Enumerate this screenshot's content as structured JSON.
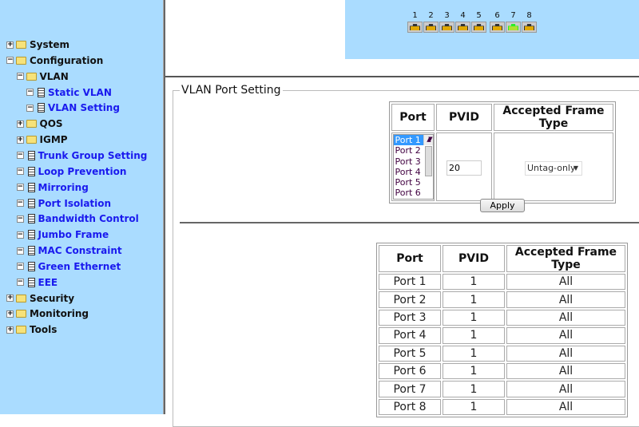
{
  "sidebar": {
    "items": [
      {
        "label": "System",
        "level": 0,
        "expander": "+",
        "icon": "folder-icon",
        "color": "black"
      },
      {
        "label": "Configuration",
        "level": 0,
        "expander": "-",
        "icon": "folder-open-icon",
        "color": "black"
      },
      {
        "label": "VLAN",
        "level": 1,
        "expander": "-",
        "icon": "folder-open-icon",
        "color": "black"
      },
      {
        "label": "Static VLAN",
        "level": 2,
        "expander": "-",
        "icon": "document-icon",
        "color": "blue"
      },
      {
        "label": "VLAN Setting",
        "level": 2,
        "expander": "-",
        "icon": "document-icon",
        "color": "blue"
      },
      {
        "label": "QOS",
        "level": 1,
        "expander": "+",
        "icon": "folder-icon",
        "color": "black"
      },
      {
        "label": "IGMP",
        "level": 1,
        "expander": "+",
        "icon": "folder-icon",
        "color": "black"
      },
      {
        "label": "Trunk Group Setting",
        "level": 1,
        "expander": "-",
        "icon": "document-icon",
        "color": "blue"
      },
      {
        "label": "Loop Prevention",
        "level": 1,
        "expander": "-",
        "icon": "document-icon",
        "color": "blue"
      },
      {
        "label": "Mirroring",
        "level": 1,
        "expander": "-",
        "icon": "document-icon",
        "color": "blue"
      },
      {
        "label": "Port Isolation",
        "level": 1,
        "expander": "-",
        "icon": "document-icon",
        "color": "blue"
      },
      {
        "label": "Bandwidth Control",
        "level": 1,
        "expander": "-",
        "icon": "document-icon",
        "color": "blue"
      },
      {
        "label": "Jumbo Frame",
        "level": 1,
        "expander": "-",
        "icon": "document-icon",
        "color": "blue"
      },
      {
        "label": "MAC Constraint",
        "level": 1,
        "expander": "-",
        "icon": "document-icon",
        "color": "blue"
      },
      {
        "label": "Green Ethernet",
        "level": 1,
        "expander": "-",
        "icon": "document-icon",
        "color": "blue"
      },
      {
        "label": "EEE",
        "level": 1,
        "expander": "-",
        "icon": "document-icon",
        "color": "blue"
      },
      {
        "label": "Security",
        "level": 0,
        "expander": "+",
        "icon": "folder-icon",
        "color": "black"
      },
      {
        "label": "Monitoring",
        "level": 0,
        "expander": "+",
        "icon": "folder-icon",
        "color": "black"
      },
      {
        "label": "Tools",
        "level": 0,
        "expander": "+",
        "icon": "folder-icon",
        "color": "black"
      }
    ]
  },
  "ports": [
    {
      "label": "1",
      "active": false
    },
    {
      "label": "2",
      "active": false
    },
    {
      "label": "3",
      "active": false
    },
    {
      "label": "4",
      "active": false
    },
    {
      "label": "5",
      "active": false
    },
    {
      "label": "6",
      "active": false
    },
    {
      "label": "7",
      "active": true
    },
    {
      "label": "8",
      "active": false
    }
  ],
  "colors": {
    "sidebar_bg": "#aadcff",
    "link": "#1a1aee",
    "port_active": "#2aee2a",
    "port_idle": "#333333"
  },
  "setting": {
    "legend": "VLAN Port Setting",
    "headers": [
      "Port",
      "PVID",
      "Accepted Frame Type"
    ],
    "port_options": [
      "Port 1",
      "Port 2",
      "Port 3",
      "Port 4",
      "Port 5",
      "Port 6"
    ],
    "selected_port": "Port 1",
    "pvid_value": "20",
    "frame_type_selected": "Untag-only",
    "apply_label": "Apply"
  },
  "summary": {
    "headers": [
      "Port",
      "PVID",
      "Accepted Frame Type"
    ],
    "rows": [
      [
        "Port 1",
        "1",
        "All"
      ],
      [
        "Port 2",
        "1",
        "All"
      ],
      [
        "Port 3",
        "1",
        "All"
      ],
      [
        "Port 4",
        "1",
        "All"
      ],
      [
        "Port 5",
        "1",
        "All"
      ],
      [
        "Port 6",
        "1",
        "All"
      ],
      [
        "Port 7",
        "1",
        "All"
      ],
      [
        "Port 8",
        "1",
        "All"
      ]
    ]
  }
}
